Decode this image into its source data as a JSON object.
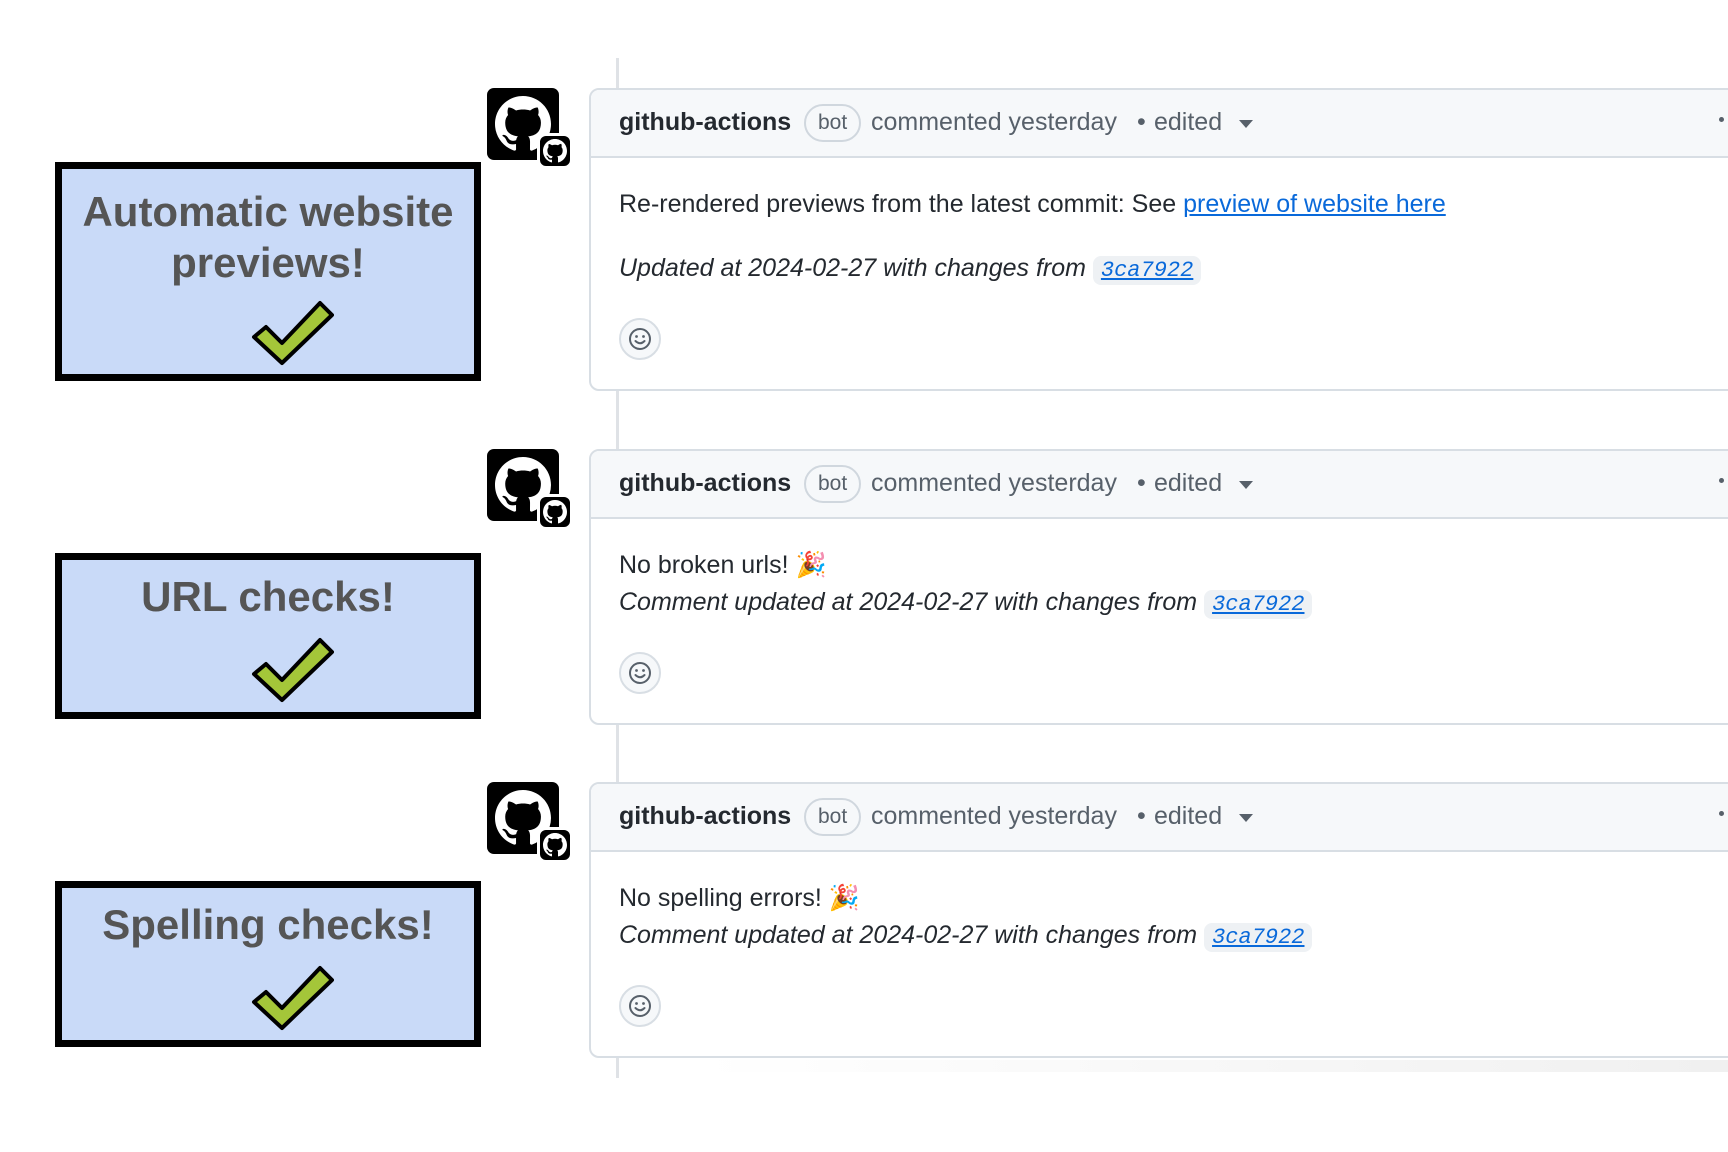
{
  "callouts": [
    {
      "line1": "Automatic website",
      "line2": "previews!"
    },
    {
      "line1": "URL checks!"
    },
    {
      "line1": "Spelling checks!"
    }
  ],
  "comments": [
    {
      "author": "github-actions",
      "badge": "bot",
      "meta": "commented yesterday",
      "separator": "•",
      "edited": "edited",
      "line1_text": "Re-rendered previews from the latest commit: See ",
      "line1_link": "preview of website here",
      "line2_text": "Updated at 2024-02-27 with changes from ",
      "sha": "3ca7922"
    },
    {
      "author": "github-actions",
      "badge": "bot",
      "meta": "commented yesterday",
      "separator": "•",
      "edited": "edited",
      "line1_text": "No broken urls! 🎉",
      "line2_text": "Comment updated at 2024-02-27 with changes from ",
      "sha": "3ca7922"
    },
    {
      "author": "github-actions",
      "badge": "bot",
      "meta": "commented yesterday",
      "separator": "•",
      "edited": "edited",
      "line1_text": "No spelling errors! 🎉",
      "line2_text": "Comment updated at 2024-02-27 with changes from ",
      "sha": "3ca7922"
    }
  ],
  "colors": {
    "callout_bg": "#c9daf8",
    "check_green": "#a4c639",
    "link": "#0969da"
  },
  "icons": {
    "avatar": "github-octocat-icon",
    "reaction": "smiley-icon",
    "check": "checkmark-icon"
  }
}
